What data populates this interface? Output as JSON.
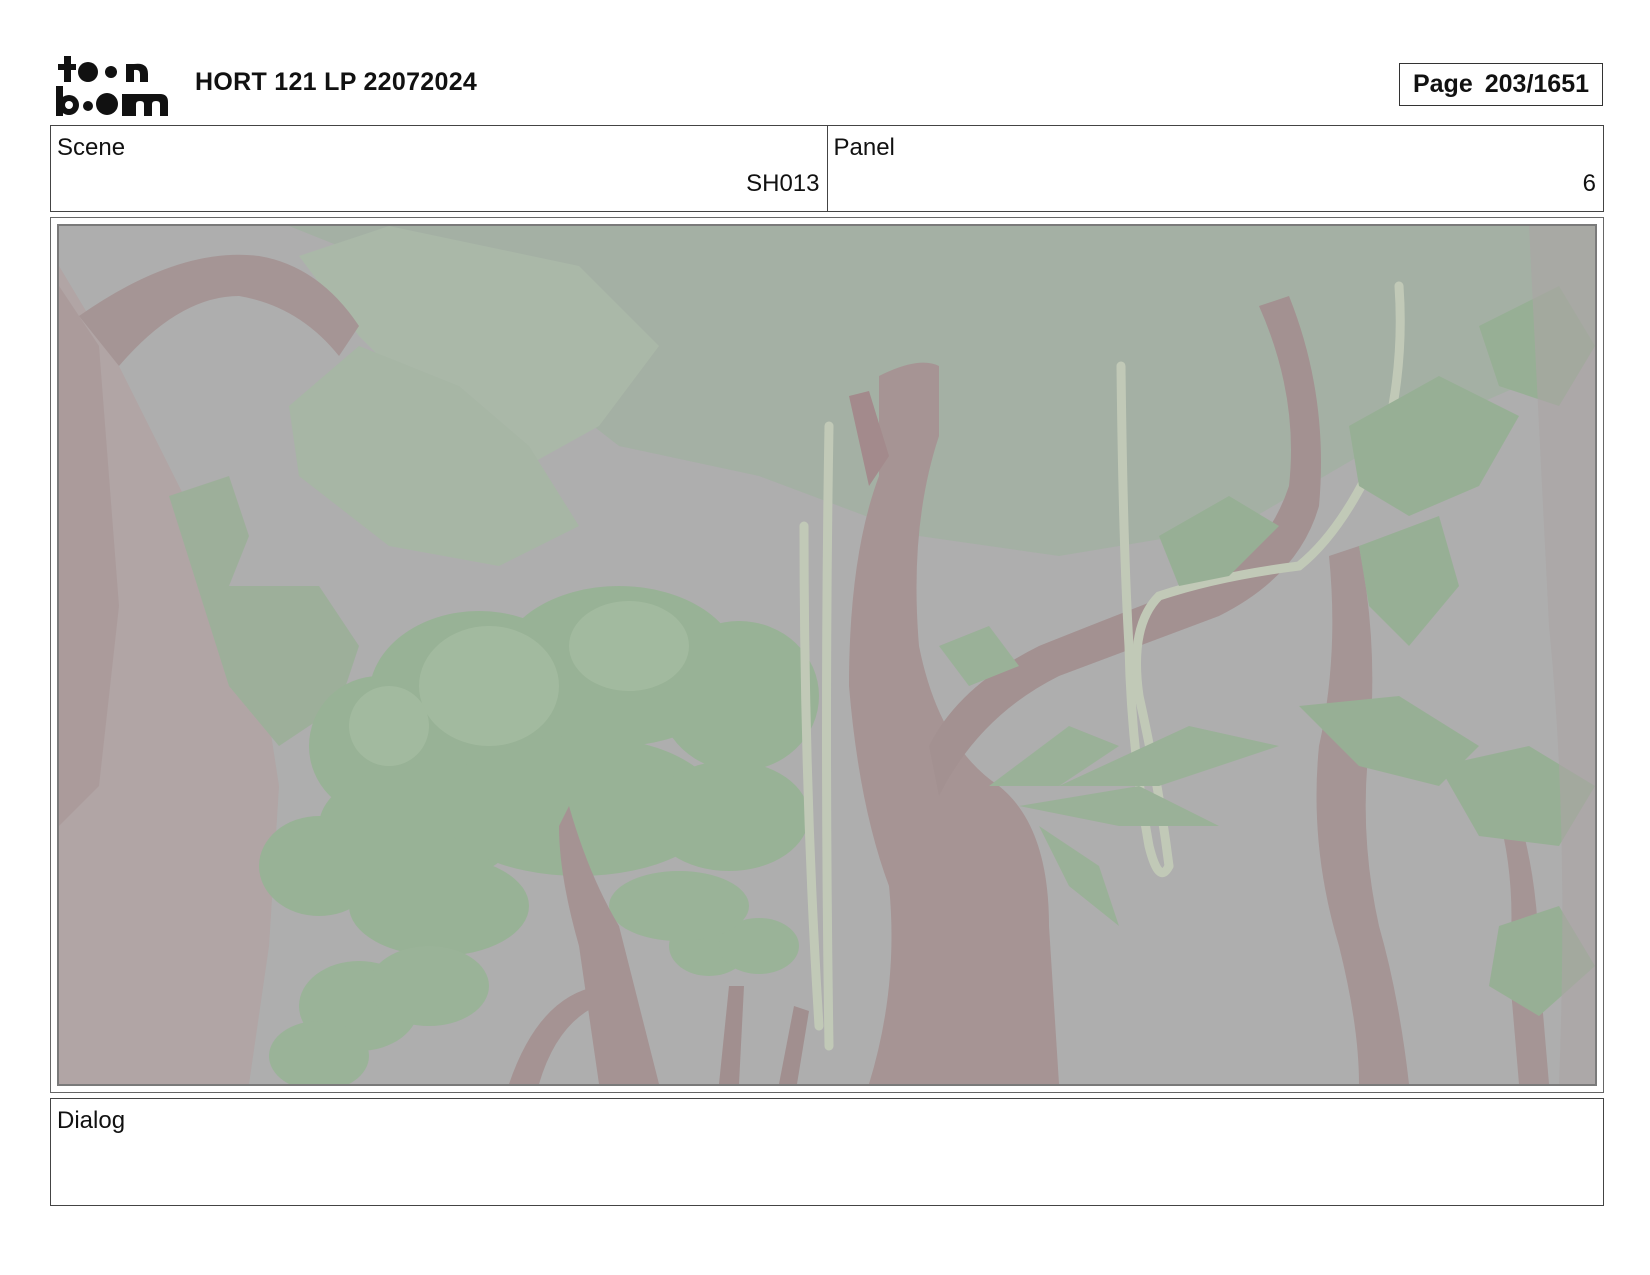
{
  "header": {
    "logo_text": "toon boom",
    "project_title": "HORT 121 LP 22072024",
    "page_label": "Page",
    "page_number": "203/1651"
  },
  "scene": {
    "label": "Scene",
    "value": "SH013"
  },
  "panel": {
    "label": "Panel",
    "value": "6"
  },
  "dialog": {
    "label": "Dialog",
    "text": ""
  },
  "colors": {
    "background_grey": "#acacac",
    "foliage_green": "#8fb08f",
    "trunk_brown": "#9c7f7f",
    "vine_pale": "#c3cdb6"
  }
}
